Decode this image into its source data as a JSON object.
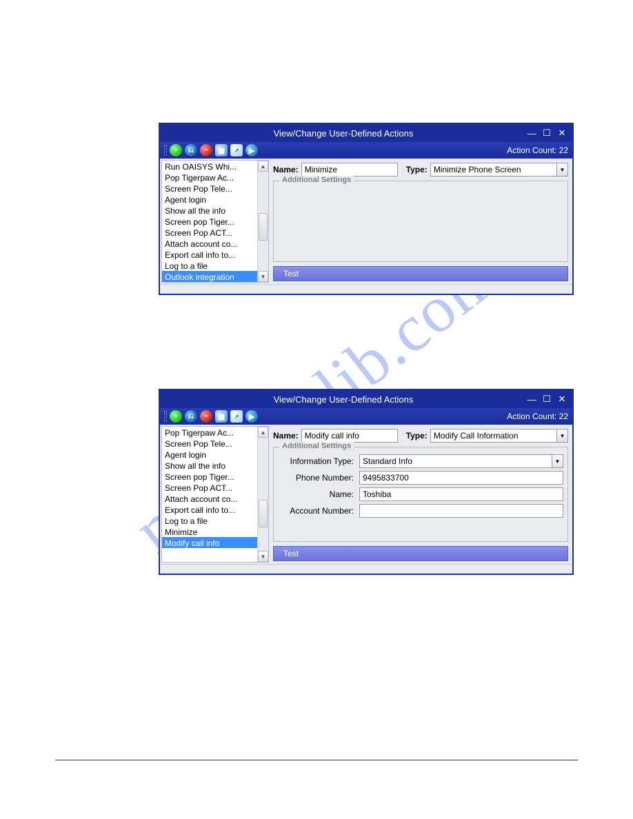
{
  "watermark": "manualslib.com",
  "window1": {
    "title": "View/Change User-Defined Actions",
    "action_count": "Action Count: 22",
    "list": {
      "items": [
        "Run OAISYS Whi...",
        "Pop Tigerpaw Ac...",
        "Screen Pop Tele...",
        "Agent login",
        "Show all the info",
        "Screen pop Tiger...",
        "Screen Pop ACT...",
        "Attach account co...",
        "Export call info to...",
        "Log to a file",
        "Outlook integration"
      ],
      "selected_index": 10
    },
    "form": {
      "name_label": "Name:",
      "name_value": "Minimize",
      "type_label": "Type:",
      "type_value": "Minimize Phone Screen",
      "additional_settings_legend": "Additional Settings"
    },
    "test_button": "Test",
    "toolbar_icons": {
      "add": "+",
      "copy": "⎘",
      "del": "−",
      "save": "💾",
      "ext": "☐",
      "play": "▶"
    },
    "winbtns": {
      "min": "—",
      "max": "☐",
      "close": "✕"
    }
  },
  "window2": {
    "title": "View/Change User-Defined Actions",
    "action_count": "Action Count: 22",
    "list": {
      "items": [
        "Pop Tigerpaw Ac...",
        "Screen Pop Tele...",
        "Agent login",
        "Show all the info",
        "Screen pop Tiger...",
        "Screen Pop ACT...",
        "Attach account co...",
        "Export call info to...",
        "Log to a file",
        "Minimize",
        "Modify call info"
      ],
      "selected_index": 10
    },
    "form": {
      "name_label": "Name:",
      "name_value": "Modify call info",
      "type_label": "Type:",
      "type_value": "Modify Call Information",
      "additional_settings_legend": "Additional Settings",
      "info_type_label": "Information Type:",
      "info_type_value": "Standard Info",
      "phone_label": "Phone Number:",
      "phone_value": "9495833700",
      "name2_label": "Name:",
      "name2_value": "Toshiba",
      "acct_label": "Account Number:",
      "acct_value": ""
    },
    "test_button": "Test"
  }
}
